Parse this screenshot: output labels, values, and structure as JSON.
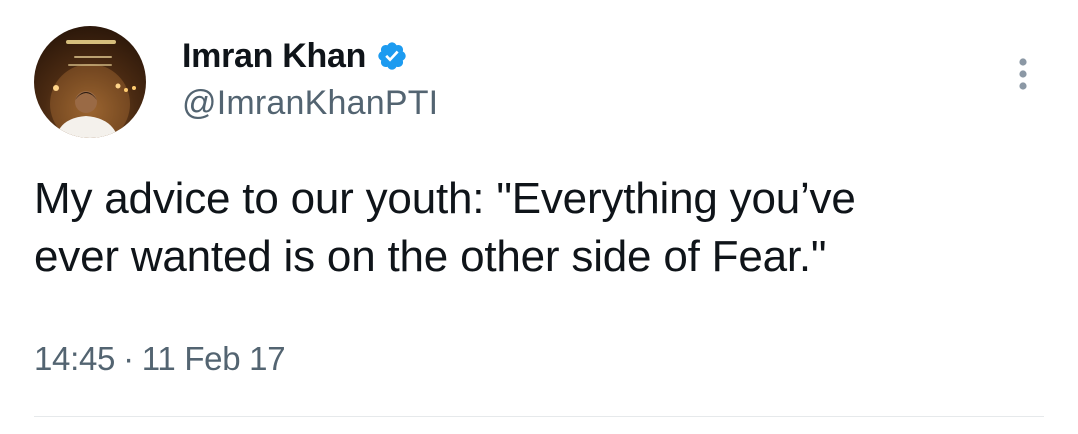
{
  "author": {
    "display_name": "Imran Khan",
    "handle": "@ImranKhanPTI",
    "verified": true,
    "avatar_icon": "profile-photo"
  },
  "tweet": {
    "text": "My advice to our youth: \"Everything you’ve\never wanted is on the other side of Fear.\"",
    "time": "14:45",
    "separator": "·",
    "date": "11 Feb 17"
  },
  "icons": {
    "verified": "verified-badge-icon",
    "more": "more-options-icon"
  },
  "colors": {
    "verified_blue": "#1d9bf0",
    "text_primary": "#0f1419",
    "text_secondary": "#536471",
    "divider": "#e6e9eb"
  }
}
